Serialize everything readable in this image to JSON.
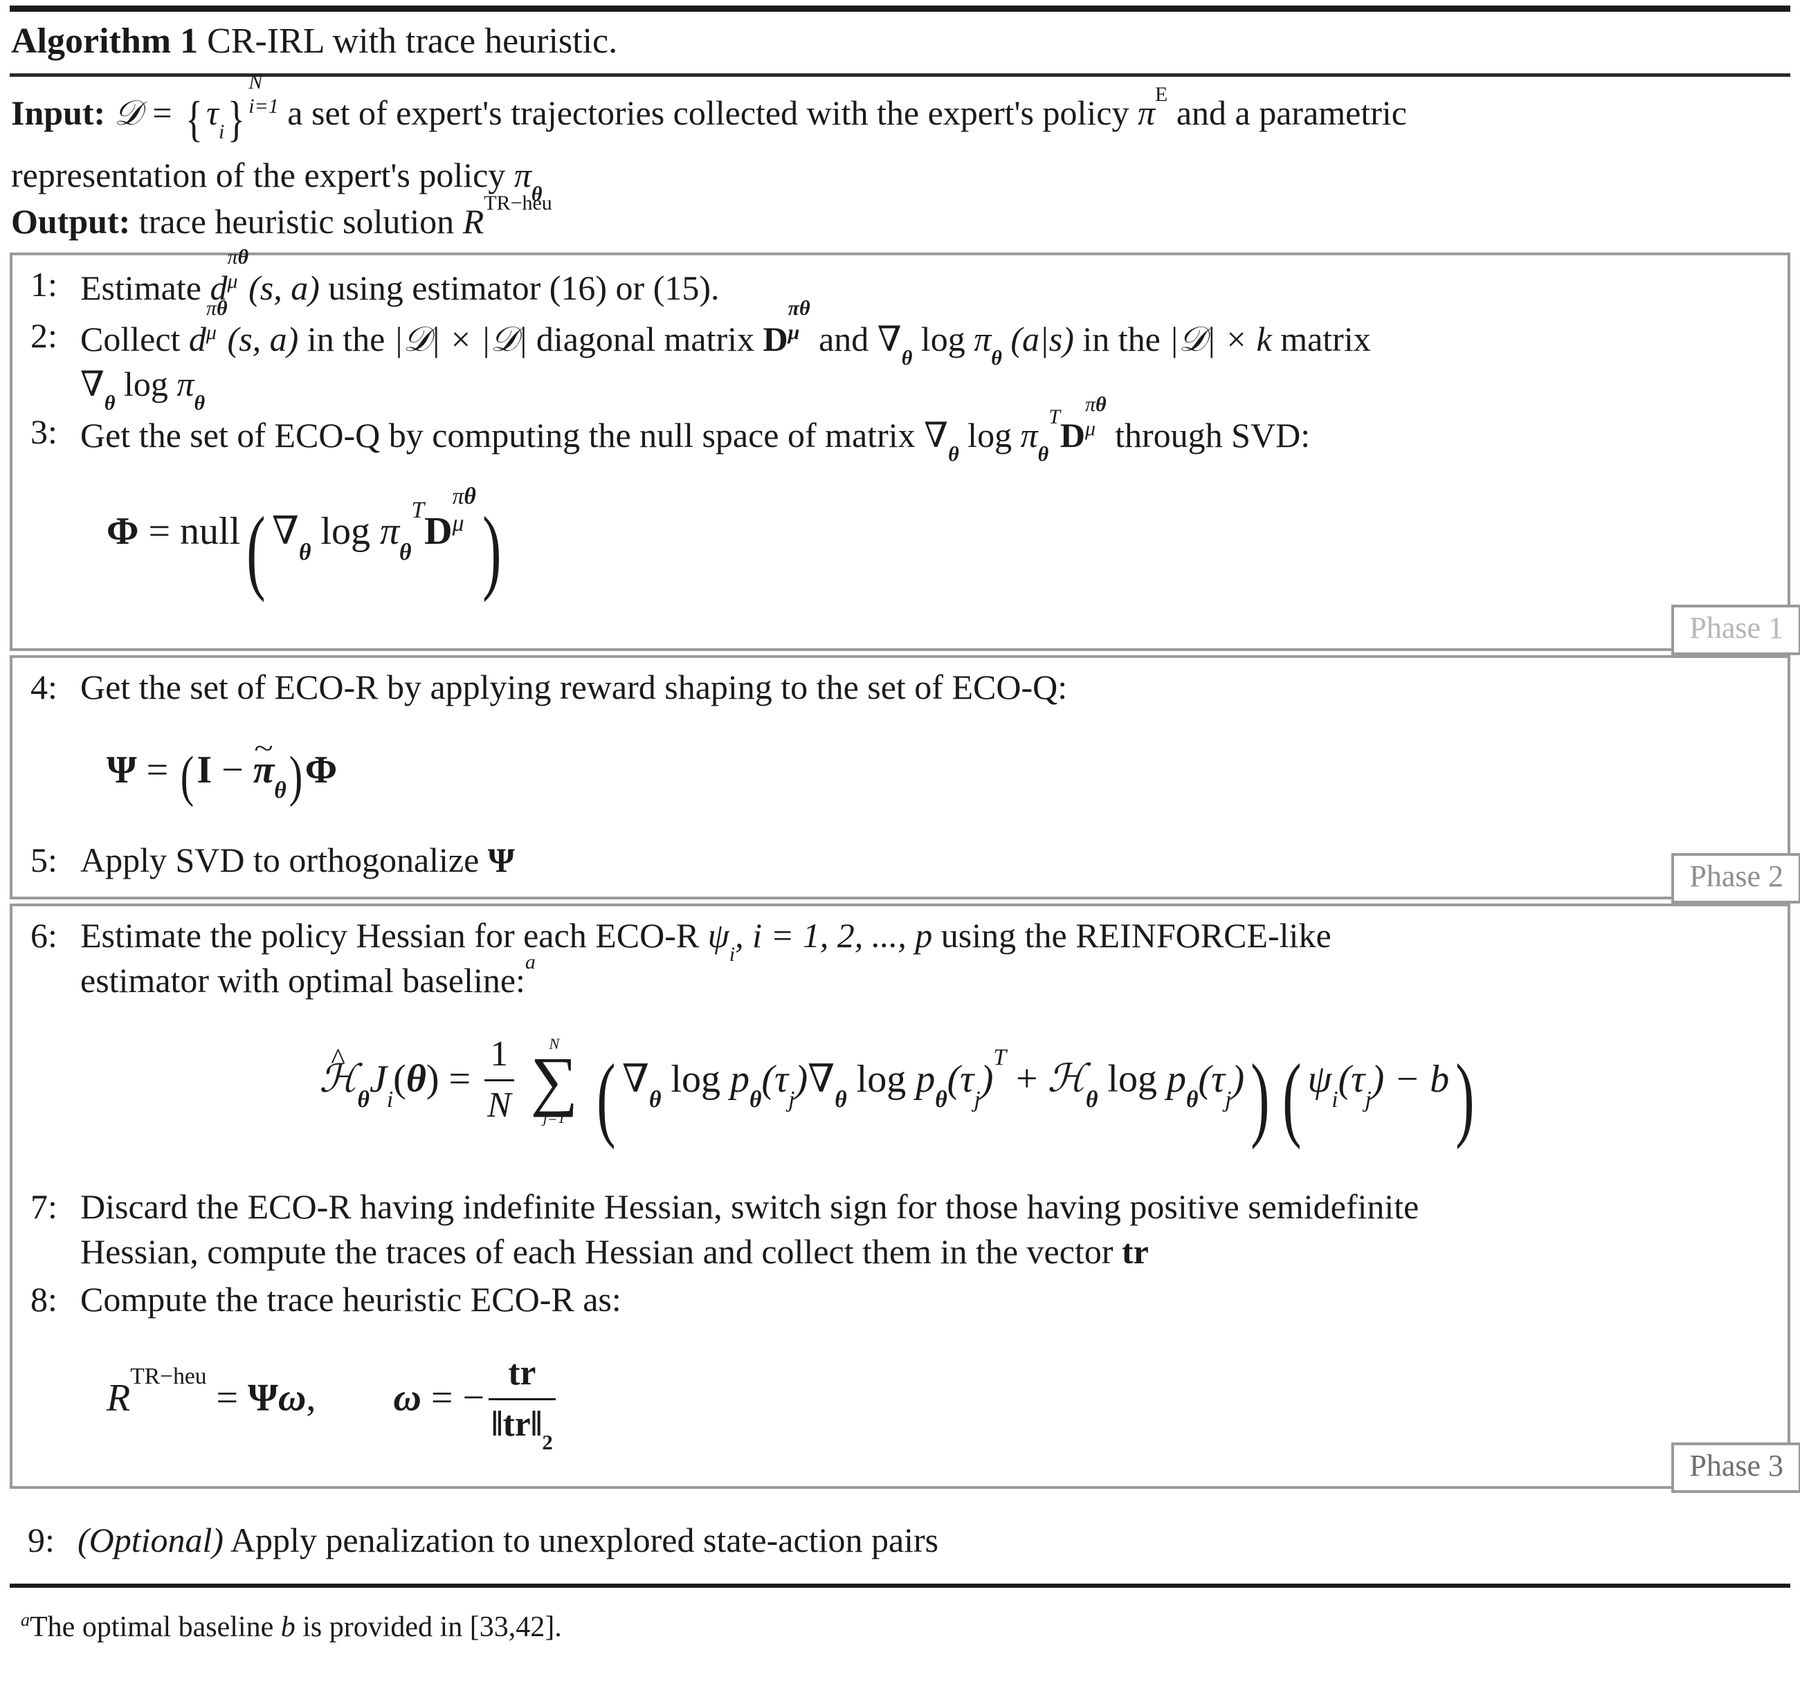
{
  "header": {
    "algorithm_label": "Algorithm 1",
    "title": "CR-IRL with trace heuristic."
  },
  "io": {
    "input_label": "Input:",
    "input_text_part1": "a set of expert's trajectories collected with the expert's policy",
    "input_text_part2": "and a parametric",
    "input_text_line2_pre": "representation of the expert's policy",
    "output_label": "Output:",
    "output_text": "trace heuristic solution"
  },
  "phases": [
    {
      "tag": "Phase 1",
      "tag_color": "#b6b6b6",
      "steps": [
        {
          "num": "1:",
          "text_a": "Estimate",
          "text_b": "using estimator (16) or (15)."
        },
        {
          "num": "2:",
          "text_a": "Collect",
          "text_b": "in the",
          "text_c": "diagonal matrix",
          "text_d": "and",
          "text_e": "in the",
          "text_f": "matrix"
        },
        {
          "num": "3:",
          "text_a": "Get the set of ECO-Q by computing the null space of matrix",
          "text_b": "through SVD:"
        }
      ],
      "equation": "Phi = null( grad_theta log pi_theta ^T D_mu^{pi theta} )"
    },
    {
      "tag": "Phase 2",
      "tag_color": "#8f8f8f",
      "steps": [
        {
          "num": "4:",
          "text_a": "Get the set of ECO-R by applying reward shaping to the set of ECO-Q:"
        },
        {
          "num": "5:",
          "text_a": "Apply SVD to orthogonalize"
        }
      ],
      "equation": "Psi = (I - tilde-pi_theta) Phi"
    },
    {
      "tag": "Phase 3",
      "tag_color": "#6e6e6e",
      "steps": [
        {
          "num": "6:",
          "text_a": "Estimate the policy Hessian for each ECO-R",
          "text_b": "using the REINFORCE-like",
          "text_c": "estimator with optimal baseline:",
          "footnote_marker": "a"
        },
        {
          "num": "7:",
          "text_a": "Discard the ECO-R having indefinite Hessian, switch sign for those having positive semidefinite",
          "text_b": "Hessian, compute the traces of each Hessian and collect them in the vector"
        },
        {
          "num": "8:",
          "text_a": "Compute the trace heuristic ECO-R as:"
        }
      ],
      "equation_hessian": "hat-H_theta J_i(theta) = (1/N) sum_{j=1}^{N} ( grad log p(tau_j) grad log p(tau_j)^T + H log p(tau_j) )( psi_i(tau_j) - b )",
      "equation_reward": "R^{TR-heu} = Psi omega,  omega = - tr / ||tr||_2"
    }
  ],
  "optional_step": {
    "num": "9:",
    "italic_prefix": "(Optional)",
    "text": "Apply penalization to unexplored state-action pairs"
  },
  "footnote": {
    "marker": "a",
    "text_pre": "The optimal baseline",
    "symbol": "b",
    "text_post": "is provided in [33,42]."
  },
  "colors": {
    "rule": "#1b1b1b",
    "box_border": "#9a9a9a",
    "text": "#1a1a1a"
  }
}
